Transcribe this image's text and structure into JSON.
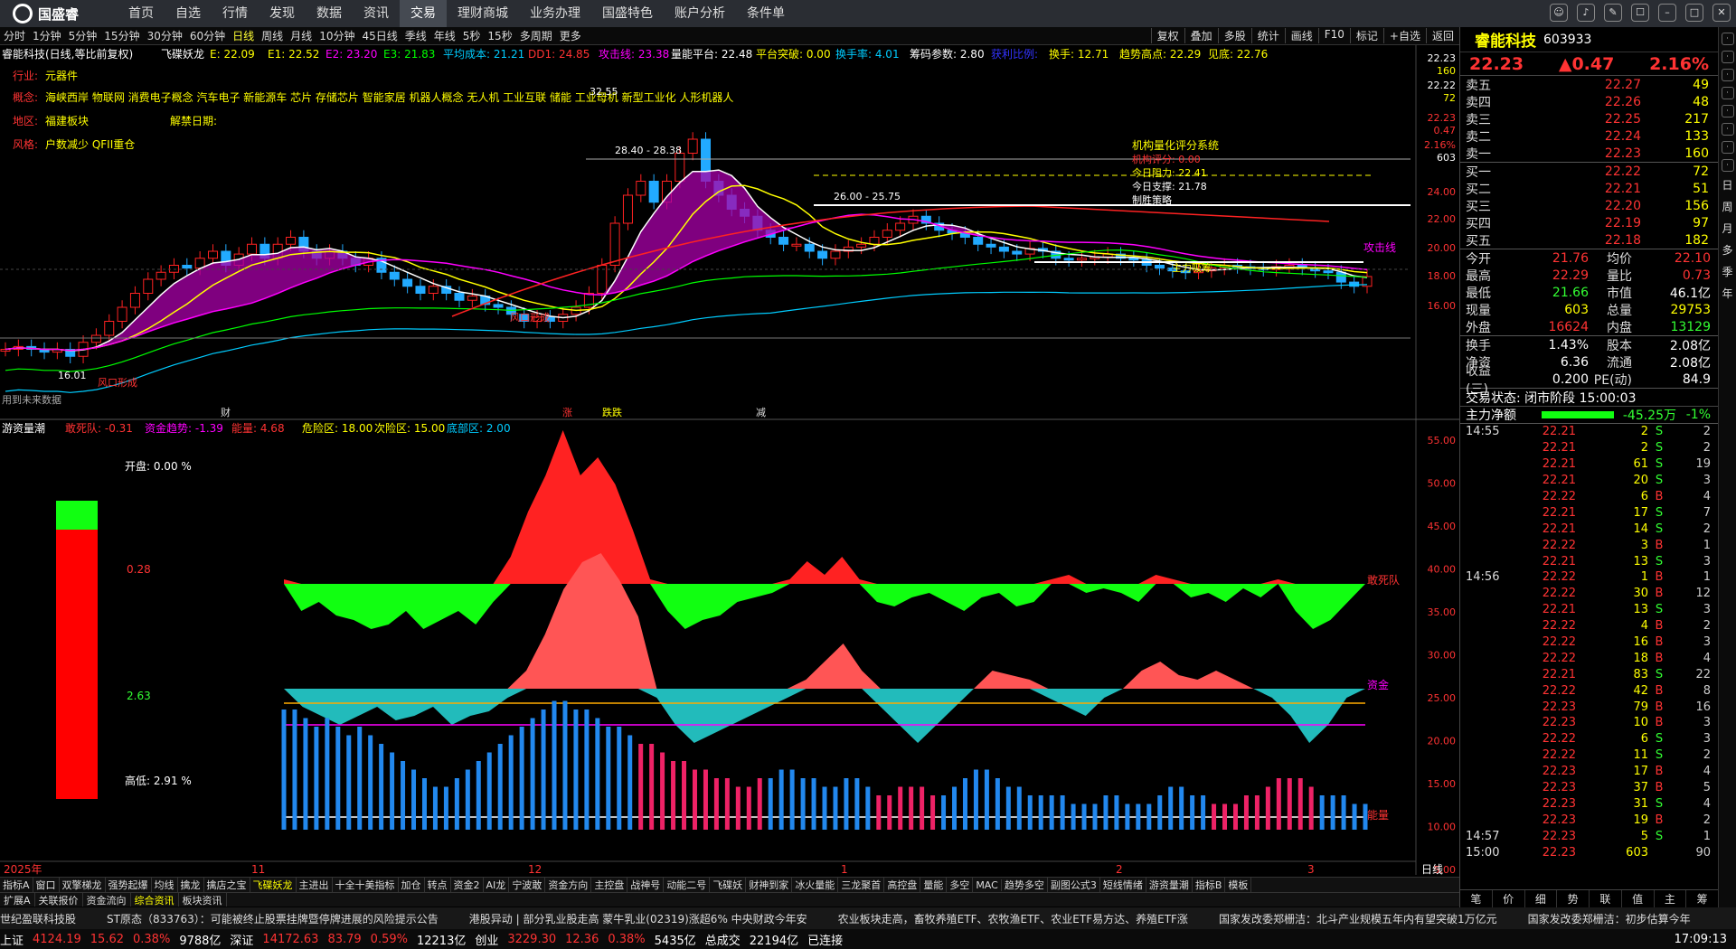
{
  "app": {
    "logo": "国盛睿"
  },
  "menu": [
    "首页",
    "自选",
    "行情",
    "发现",
    "数据",
    "资讯",
    "交易",
    "理财商城",
    "业务办理",
    "国盛特色",
    "账户分析",
    "条件单"
  ],
  "menu_active": "交易",
  "periods": [
    "分时",
    "1分钟",
    "5分钟",
    "15分钟",
    "30分钟",
    "60分钟",
    "日线",
    "周线",
    "月线",
    "10分钟",
    "45日线",
    "季线",
    "年线",
    "5秒",
    "15秒",
    "多周期",
    "更多"
  ],
  "period_active": "日线",
  "right_tools": [
    "复权",
    "叠加",
    "多股",
    "统计",
    "画线",
    "F10",
    "标记",
    "+自选",
    "返回"
  ],
  "header": {
    "stock": "睿能科技(日线,等比前复权)",
    "indicator": "飞碟妖龙",
    "E": "E: 22.09",
    "E1": "E1: 22.52",
    "E2": "E2: 23.20",
    "E3": "E3: 21.83",
    "avgcost": "平均成本: 21.21",
    "dd1": "DD1: 24.85",
    "attack": "攻击线: 23.38",
    "volplat": "量能平台: 22.48",
    "platbreak": "平台突破: 0.00",
    "turnrate": "换手率: 4.01",
    "chip": "筹码参数: 2.80",
    "clear": "获利比例:",
    "turn": "换手: 12.71",
    "trend": "趋势高点: 22.29",
    "bottom": "见底: 22.76"
  },
  "info_lines": {
    "industry_label": "行业:",
    "industry": "元器件",
    "concept_label": "概念:",
    "concept": "海峡西岸 物联网 消费电子概念 汽车电子 新能源车 芯片 存储芯片 智能家居 机器人概念 无人机 工业互联 储能 工业母机 新型工业化 人形机器人",
    "region_label": "地区:",
    "region": "福建板块",
    "unlock_label": "解禁日期:",
    "style_label": "风格:",
    "style": "户数减少 QFII重仓"
  },
  "price_axis": [
    "22.23",
    "160",
    "22.22",
    "72",
    "22.23",
    "0.47",
    "2.16%",
    "603",
    "24.00",
    "22.00",
    "20.00",
    "18.00",
    "16.00"
  ],
  "annotations": {
    "high": "32.55",
    "low": "16.01",
    "range1": "28.40 - 28.38",
    "range2": "26.00 - 25.75",
    "score_title": "机构量化评分系统",
    "score": "机构评分: 0.00",
    "resist": "今日阻力: 22.41",
    "support": "今日支撑: 21.78",
    "tactic": "制胜策略",
    "attack_label": "攻击线",
    "wind1": "风口形成",
    "wind2": "风口形成",
    "main": "主力吸筹",
    "forecast": "用到未来数据",
    "cai": "财",
    "zhang": "涨",
    "die": "跌跌",
    "jian": "减"
  },
  "sub_header": {
    "name": "游资量潮",
    "a": "敢死队: -0.31",
    "b": "资金趋势: -1.39",
    "c": "能量: 4.68",
    "d": "危险区: 18.00",
    "e": "次险区: 15.00",
    "f": "底部区: 2.00"
  },
  "sub_left": {
    "open": "开盘: 0.00 %",
    "v1": "0.28",
    "v2": "2.63",
    "low": "高低: 2.91 %"
  },
  "sub_axis": [
    "55.00",
    "50.00",
    "45.00",
    "40.00",
    "35.00",
    "30.00",
    "25.00",
    "20.00",
    "15.00",
    "10.00",
    "5.00"
  ],
  "sub_labels": {
    "gsd": "敢死队",
    "zj": "资金",
    "nl": "能量"
  },
  "dates": [
    "2025年",
    "11",
    "12",
    "1",
    "2",
    "3"
  ],
  "date_right": "日线",
  "tabs": [
    "指标A",
    "窗口",
    "双擎梯龙",
    "强势起爆",
    "均线",
    "擒龙",
    "擒店之宝",
    "飞碟妖龙",
    "主进出",
    "十全十美指标",
    "加仓",
    "转点",
    "资金2",
    "AI龙",
    "宁波敢",
    "资金方向",
    "主控盘",
    "战神号",
    "动能二号",
    "飞碟妖",
    "财神到家",
    "冰火量能",
    "三龙聚首",
    "高控盘",
    "量能",
    "多空",
    "MAC",
    "趋势多空",
    "副图公式3",
    "短线情绪",
    "游资量潮",
    "指标B",
    "模板"
  ],
  "tab_active": "飞碟妖龙",
  "tabs2": [
    "扩展A",
    "关联报价",
    "资金流向",
    "综合资讯",
    "板块资讯"
  ],
  "tabs2_active": "综合资讯",
  "news": [
    "世纪盈联科技股",
    "ST原态（833763）：可能被终止股票挂牌暨停牌进展的风险提示公告",
    "港股异动 | 部分乳业股走高 蒙牛乳业(02319)涨超6% 中央财政今年安",
    "农业板块走高，畜牧养殖ETF、农牧渔ETF、农业ETF易方达、养殖ETF涨",
    "国家发改委郑栅洁：北斗产业规模五年内有望突破1万亿元",
    "国家发改委郑栅洁：初步估算今年"
  ],
  "status": {
    "sh_label": "上证",
    "sh": "4124.19",
    "sh_chg": "15.62",
    "sh_pct": "0.38%",
    "sh_amt": "9788亿",
    "sz_label": "深证",
    "sz": "14172.63",
    "sz_chg": "83.79",
    "sz_pct": "0.59%",
    "sz_amt": "12213亿",
    "cy_label": "创业",
    "cy": "3229.30",
    "cy_chg": "12.36",
    "cy_pct": "0.38%",
    "cy_amt": "5435亿",
    "total_label": "总成交",
    "total": "22194亿",
    "conn": "已连接",
    "time": "17:09:13"
  },
  "right": {
    "name": "睿能科技",
    "code": "603933",
    "price": "22.23",
    "chg": "▲0.47",
    "pct": "2.16%",
    "asks": [
      {
        "l": "卖五",
        "p": "22.27",
        "v": "49"
      },
      {
        "l": "卖四",
        "p": "22.26",
        "v": "48"
      },
      {
        "l": "卖三",
        "p": "22.25",
        "v": "217"
      },
      {
        "l": "卖二",
        "p": "22.24",
        "v": "133"
      },
      {
        "l": "卖一",
        "p": "22.23",
        "v": "160"
      }
    ],
    "bids": [
      {
        "l": "买一",
        "p": "22.22",
        "v": "72"
      },
      {
        "l": "买二",
        "p": "22.21",
        "v": "51"
      },
      {
        "l": "买三",
        "p": "22.20",
        "v": "156"
      },
      {
        "l": "买四",
        "p": "22.19",
        "v": "97"
      },
      {
        "l": "买五",
        "p": "22.18",
        "v": "182"
      }
    ],
    "stats": [
      {
        "a": "今开",
        "b": "21.76",
        "c": "均价",
        "d": "22.10"
      },
      {
        "a": "最高",
        "b": "22.29",
        "c": "量比",
        "d": "0.73"
      },
      {
        "a": "最低",
        "b": "21.66",
        "c": "市值",
        "d": "46.1亿"
      },
      {
        "a": "现量",
        "b": "603",
        "c": "总量",
        "d": "29753"
      },
      {
        "a": "外盘",
        "b": "16624",
        "c": "内盘",
        "d": "13129"
      }
    ],
    "stats2": [
      {
        "a": "换手",
        "b": "1.43%",
        "c": "股本",
        "d": "2.08亿"
      },
      {
        "a": "净资",
        "b": "6.36",
        "c": "流通",
        "d": "2.08亿"
      },
      {
        "a": "收益(三)",
        "b": "0.200",
        "c": "PE(动)",
        "d": "84.9"
      }
    ],
    "state": "交易状态: 闭市阶段 15:00:03",
    "flow_label": "主力净额",
    "flow": "-45.25万",
    "flow_pct": "-1%",
    "ticks": [
      {
        "t": "14:55",
        "p": "22.21",
        "v": "2",
        "b": "S",
        "n": "2"
      },
      {
        "t": "",
        "p": "22.21",
        "v": "2",
        "b": "S",
        "n": "2"
      },
      {
        "t": "",
        "p": "22.21",
        "v": "61",
        "b": "S",
        "n": "19"
      },
      {
        "t": "",
        "p": "22.21",
        "v": "20",
        "b": "S",
        "n": "3"
      },
      {
        "t": "",
        "p": "22.22",
        "v": "6",
        "b": "B",
        "n": "4"
      },
      {
        "t": "",
        "p": "22.21",
        "v": "17",
        "b": "S",
        "n": "7"
      },
      {
        "t": "",
        "p": "22.21",
        "v": "14",
        "b": "S",
        "n": "2"
      },
      {
        "t": "",
        "p": "22.22",
        "v": "3",
        "b": "B",
        "n": "1"
      },
      {
        "t": "",
        "p": "22.21",
        "v": "13",
        "b": "S",
        "n": "3"
      },
      {
        "t": "14:56",
        "p": "22.22",
        "v": "1",
        "b": "B",
        "n": "1"
      },
      {
        "t": "",
        "p": "22.22",
        "v": "30",
        "b": "B",
        "n": "12"
      },
      {
        "t": "",
        "p": "22.21",
        "v": "13",
        "b": "S",
        "n": "3"
      },
      {
        "t": "",
        "p": "22.22",
        "v": "4",
        "b": "B",
        "n": "2"
      },
      {
        "t": "",
        "p": "22.22",
        "v": "16",
        "b": "B",
        "n": "3"
      },
      {
        "t": "",
        "p": "22.22",
        "v": "18",
        "b": "B",
        "n": "4"
      },
      {
        "t": "",
        "p": "22.21",
        "v": "83",
        "b": "S",
        "n": "22"
      },
      {
        "t": "",
        "p": "22.22",
        "v": "42",
        "b": "B",
        "n": "8"
      },
      {
        "t": "",
        "p": "22.23",
        "v": "79",
        "b": "B",
        "n": "16"
      },
      {
        "t": "",
        "p": "22.23",
        "v": "10",
        "b": "B",
        "n": "3"
      },
      {
        "t": "",
        "p": "22.22",
        "v": "6",
        "b": "S",
        "n": "3"
      },
      {
        "t": "",
        "p": "22.22",
        "v": "11",
        "b": "S",
        "n": "2"
      },
      {
        "t": "",
        "p": "22.23",
        "v": "17",
        "b": "B",
        "n": "4"
      },
      {
        "t": "",
        "p": "22.23",
        "v": "37",
        "b": "B",
        "n": "5"
      },
      {
        "t": "",
        "p": "22.23",
        "v": "31",
        "b": "S",
        "n": "4"
      },
      {
        "t": "",
        "p": "22.23",
        "v": "19",
        "b": "B",
        "n": "2"
      },
      {
        "t": "14:57",
        "p": "22.23",
        "v": "5",
        "b": "S",
        "n": "1"
      },
      {
        "t": "15:00",
        "p": "22.23",
        "v": "603",
        "b": "",
        "n": "90"
      }
    ],
    "btabs": [
      "笔",
      "价",
      "细",
      "势",
      "联",
      "值",
      "主",
      "筹"
    ]
  },
  "vbar": [
    "日",
    "周",
    "月",
    "多",
    "季",
    "年"
  ]
}
